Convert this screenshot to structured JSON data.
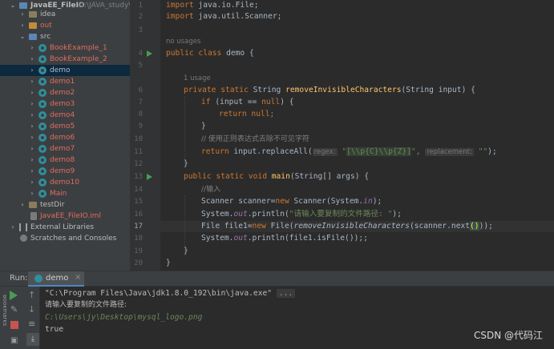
{
  "project_tree": {
    "root": {
      "name": "JavaEE_FileIO",
      "path": "D:\\JAVA_study\\"
    },
    "items": [
      {
        "label": "idea"
      },
      {
        "label": "out"
      },
      {
        "label": "src"
      },
      {
        "label": "BookExample_1"
      },
      {
        "label": "BookExample_2"
      },
      {
        "label": "demo"
      },
      {
        "label": "demo1"
      },
      {
        "label": "demo2"
      },
      {
        "label": "demo3"
      },
      {
        "label": "demo4"
      },
      {
        "label": "demo5"
      },
      {
        "label": "demo6"
      },
      {
        "label": "demo7"
      },
      {
        "label": "demo8"
      },
      {
        "label": "demo9"
      },
      {
        "label": "demo10"
      },
      {
        "label": "Main"
      },
      {
        "label": "testDir"
      },
      {
        "label": "JavaEE_FileIO.iml"
      },
      {
        "label": "External Libraries"
      },
      {
        "label": "Scratches and Consoles"
      }
    ]
  },
  "editor": {
    "line_numbers": [
      "1",
      "2",
      "3",
      "4",
      "5",
      "6",
      "7",
      "8",
      "9",
      "10",
      "11",
      "12",
      "13",
      "14",
      "15",
      "16",
      "17",
      "18",
      "19",
      "20"
    ],
    "usage_hints": {
      "no_usages": "no usages",
      "one_usage": "1 usage"
    },
    "param_hints": {
      "regex": "regex:",
      "replacement": "replacement:"
    },
    "code": {
      "l1_kw": "import",
      "l1_rest": " java.io.File;",
      "l2_kw": "import",
      "l2_rest": " java.util.Scanner;",
      "l4_kw": "public class",
      "l4_rest": " demo {",
      "l6_kw": "private static",
      "l6_type": " String ",
      "l6_fn": "removeInvisibleCharacters",
      "l6_rest": "(String input) {",
      "l7_kw": "if",
      "l7_a": " (input == ",
      "l7_null": "null",
      "l7_b": ") {",
      "l8_kw": "return",
      "l8_null": " null",
      "l8_end": ";",
      "l9": "}",
      "l10": "// 使用正则表达式去除不可见字符",
      "l11_kw": "return",
      "l11_a": " input.replaceAll(",
      "l11_q1": "\"",
      "l11_rx": "[\\\\p{C}\\\\p{Z}]",
      "l11_q2": "\"",
      "l11_comma": ", ",
      "l11_s": "\"\"",
      "l11_end": ");",
      "l12": "}",
      "l13_kw": "public static void",
      "l13_fn": " main",
      "l13_rest": "(String[] args) {",
      "l14": "//输入",
      "l15_a": "Scanner scanner=",
      "l15_kw": "new",
      "l15_b": " Scanner(System.",
      "l15_in": "in",
      "l15_c": ");",
      "l16_a": "System.",
      "l16_out": "out",
      "l16_b": ".println(",
      "l16_s": "\"请输入要复制的文件路径: \"",
      "l16_c": ");",
      "l17_a": "File file1=",
      "l17_kw": "new",
      "l17_b": " File(",
      "l17_fn": "removeInvisibleCharacters",
      "l17_c": "(scanner.next",
      "l17_p": "()",
      "l17_d": "));",
      "l18_a": "System.",
      "l18_out": "out",
      "l18_b": ".println(file1.isFile());;",
      "l19": "}",
      "l20": "}"
    }
  },
  "run_panel": {
    "label": "Run:",
    "tab": "demo",
    "console": {
      "cmd": "\"C:\\Program Files\\Java\\jdk1.8.0_192\\bin\\java.exe\"",
      "fold": "...",
      "prompt": "请输入要复制的文件路径:",
      "input": "C:\\Users\\jy\\Desktop\\mysql_logo.png",
      "result": "true"
    },
    "side_label": "Bookmarks"
  },
  "watermark": "CSDN @代码江"
}
